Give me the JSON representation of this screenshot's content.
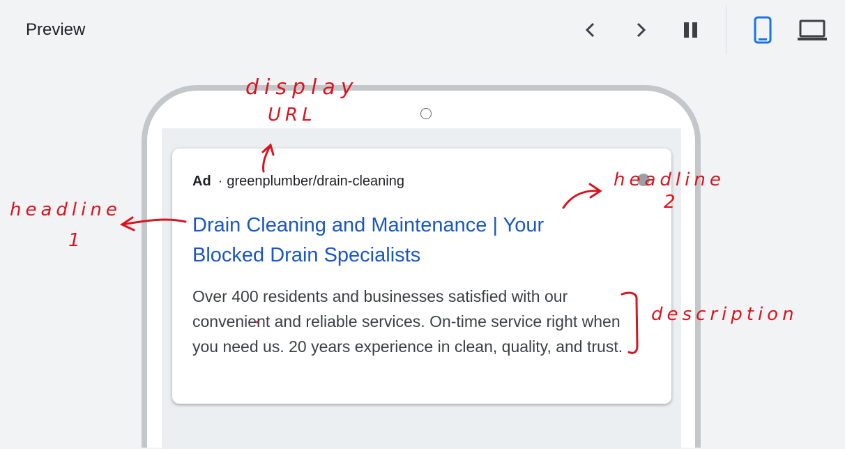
{
  "header": {
    "title": "Preview",
    "controls": {
      "prev_icon": "chevron-left-icon",
      "next_icon": "chevron-right-icon",
      "pause_icon": "pause-icon",
      "mobile_icon": "smartphone-icon",
      "desktop_icon": "laptop-icon"
    },
    "active_device": "mobile"
  },
  "ad": {
    "label": "Ad",
    "separator": "·",
    "display_url": "greenplumber/drain-cleaning",
    "headline": "Drain Cleaning and Maintenance | Your Blocked Drain Specialists",
    "description": "Over 400 residents and businesses satisfied with our convenient and reliable services. On-time service right when you need us. 20 years experience in clean, quality, and trust."
  },
  "annotations": {
    "display_url_line1": "display",
    "display_url_line2": "URL",
    "headline1_line1": "headline",
    "headline1_line2": "1",
    "headline2_line1": "headline",
    "headline2_line2": "2",
    "description": "description"
  },
  "colors": {
    "accent": "#1a73e8",
    "headline_link": "#1a56c4",
    "annotation_ink": "#d9131f",
    "background": "#f1f3f4"
  }
}
